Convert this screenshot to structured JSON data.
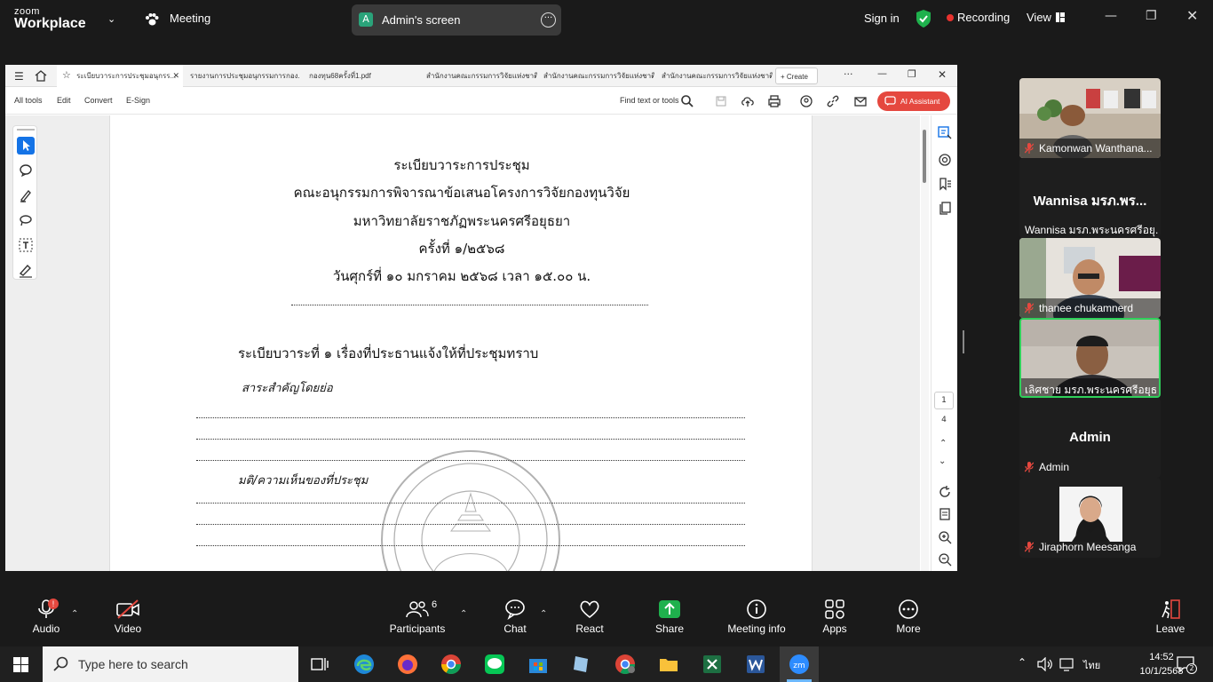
{
  "zoom": {
    "logo_line1": "zoom",
    "logo_line2": "Workplace",
    "meeting_label": "Meeting",
    "share_avatar": "A",
    "share_title": "Admin's screen",
    "sign_in": "Sign in",
    "recording": "Recording",
    "view": "View",
    "accent_green": "#2aa37a",
    "record_red": "#e8322e"
  },
  "acrobat": {
    "tabs": [
      "ระเบียบวาระการประชุมอนุกรร...",
      "รายงานการประชุมอนุกรรมการกอง...",
      "กองทุน68ครั้งที่1.pdf",
      "สำนักงานคณะกรรมการวิจัยแห่งชาติ",
      "สำนักงานคณะกรรมการวิจัยแห่งชาติ",
      "สำนักงานคณะกรรมการวิจัยแห่งชาติ"
    ],
    "create": "Create",
    "menus": [
      "All tools",
      "Edit",
      "Convert",
      "E-Sign"
    ],
    "find": "Find text or tools",
    "ai_assistant": "AI Assistant",
    "page_current": "1",
    "page_total": "4",
    "ai_color": "#e5483f"
  },
  "document": {
    "title_lines": [
      "ระเบียบวาระการประชุม",
      "คณะอนุกรรมการพิจารณาข้อเสนอโครงการวิจัยกองทุนวิจัย",
      "มหาวิทยาลัยราชภัฏพระนครศรีอยุธยา",
      "ครั้งที่ ๑/๒๕๖๘",
      "วันศุกร์ที่ ๑๐ มกราคม ๒๕๖๘ เวลา ๑๕.๐๐ น."
    ],
    "agenda_heading": "ระเบียบวาระที่ ๑ เรื่องที่ประธานแจ้งให้ที่ประชุมทราบ",
    "summary_label": "สาระสำคัญโดยย่อ",
    "resolution_label": "มติ/ความเห็นของที่ประชุม"
  },
  "participants": [
    {
      "name": "Kamonwan Wanthana...",
      "muted": true,
      "video": true
    },
    {
      "display": "Wannisa มรภ.พร...",
      "name": "Wannisa มรภ.พระนครศรีอยุ...",
      "muted": false,
      "video": false
    },
    {
      "name": "thanee chukamnerd",
      "muted": true,
      "video": true
    },
    {
      "name": "เลิศชาย มรภ.พระนครศรีอยุธยา",
      "muted": false,
      "video": true,
      "active_speaker": true
    },
    {
      "display": "Admin",
      "name": "Admin",
      "muted": true,
      "video": false
    },
    {
      "name": "Jiraphorn Meesanga",
      "muted": true,
      "video": true
    }
  ],
  "controls": {
    "audio": "Audio",
    "video": "Video",
    "participants": "Participants",
    "participants_count": "6",
    "chat": "Chat",
    "react": "React",
    "share": "Share",
    "meeting_info": "Meeting info",
    "apps": "Apps",
    "more": "More",
    "leave": "Leave",
    "audio_badge": "!"
  },
  "taskbar": {
    "search_placeholder": "Type here to search",
    "lang": "ไทย",
    "time": "14:52",
    "date": "10/1/2568",
    "notif_count": "2"
  }
}
